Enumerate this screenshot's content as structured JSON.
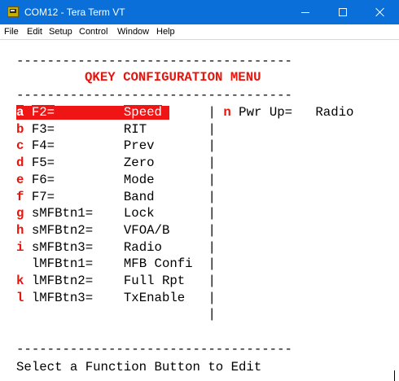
{
  "window": {
    "title": "COM12 - Tera Term VT",
    "icon": "teraterm-app-icon",
    "minimize_icon": "minimize-icon",
    "maximize_icon": "maximize-icon",
    "close_icon": "close-icon"
  },
  "menubar": {
    "items": [
      "File",
      "Edit",
      "Setup",
      "Control",
      "Window",
      "Help"
    ]
  },
  "terminal": {
    "separator": "------------------------------------",
    "title": "QKEY CONFIGURATION MENU",
    "rows": [
      {
        "key": "a",
        "label": "F2=",
        "value": "Speed",
        "selected": true
      },
      {
        "key": "b",
        "label": "F3=",
        "value": "RIT",
        "selected": false
      },
      {
        "key": "c",
        "label": "F4=",
        "value": "Prev",
        "selected": false
      },
      {
        "key": "d",
        "label": "F5=",
        "value": "Zero",
        "selected": false
      },
      {
        "key": "e",
        "label": "F6=",
        "value": "Mode",
        "selected": false
      },
      {
        "key": "f",
        "label": "F7=",
        "value": "Band",
        "selected": false
      },
      {
        "key": "g",
        "label": "sMFBtn1=",
        "value": "Lock",
        "selected": false
      },
      {
        "key": "h",
        "label": "sMFBtn2=",
        "value": "VFOA/B",
        "selected": false
      },
      {
        "key": "i",
        "label": "sMFBtn3=",
        "value": "Radio",
        "selected": false
      },
      {
        "key": "",
        "label": "lMFBtn1=",
        "value": "MFB Confi",
        "selected": false
      },
      {
        "key": "k",
        "label": "lMFBtn2=",
        "value": "Full Rpt",
        "selected": false
      },
      {
        "key": "l",
        "label": "lMFBtn3=",
        "value": "TxEnable",
        "selected": false
      }
    ],
    "right_column": {
      "key": "n",
      "label": "Pwr Up=",
      "value": "Radio"
    },
    "column_divider": "|",
    "prompt": "Select a Function Button to Edit",
    "colors": {
      "key_red": "#e8140c",
      "selection_bg": "#ef1515",
      "titlebar_blue": "#0a6fd8"
    }
  }
}
